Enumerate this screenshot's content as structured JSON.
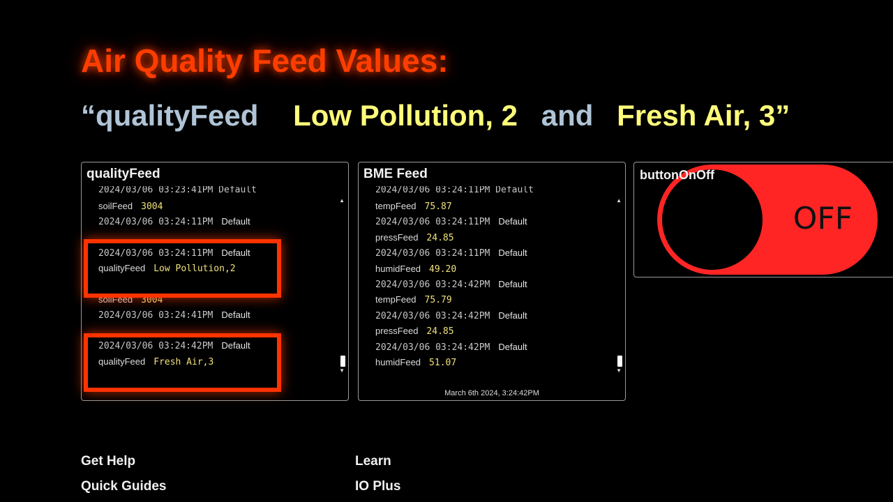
{
  "heading": "Air Quality Feed Values:",
  "subheading": {
    "open_quote": "“",
    "feed_name": "qualityFeed",
    "value1": "Low Pollution, 2",
    "and_word": "and",
    "value2": "Fresh Air, 3”"
  },
  "quality_panel": {
    "title": "qualityFeed",
    "clipped_line": "2024/03/06 03:23:41PM  Default",
    "rows": [
      {
        "feed": "soilFeed",
        "value": "3004"
      },
      {
        "timestamp": "2024/03/06 03:24:11PM",
        "group": "Default"
      },
      {
        "timestamp": "2024/03/06 03:24:11PM",
        "group": "Default"
      },
      {
        "feed": "qualityFeed",
        "value": "Low Pollution,2"
      },
      {
        "feed": "soilFeed",
        "value": "3004"
      },
      {
        "timestamp": "2024/03/06 03:24:41PM",
        "group": "Default"
      },
      {
        "timestamp": "2024/03/06 03:24:42PM",
        "group": "Default"
      },
      {
        "feed": "qualityFeed",
        "value": "Fresh Air,3"
      }
    ]
  },
  "bme_panel": {
    "title": "BME Feed",
    "clipped_line": "2024/03/06 03:24:11PM  Default",
    "rows": [
      {
        "feed": "tempFeed",
        "value": "75.87"
      },
      {
        "timestamp": "2024/03/06 03:24:11PM",
        "group": "Default"
      },
      {
        "feed": "pressFeed",
        "value": "24.85"
      },
      {
        "timestamp": "2024/03/06 03:24:11PM",
        "group": "Default"
      },
      {
        "feed": "humidFeed",
        "value": "49.20"
      },
      {
        "timestamp": "2024/03/06 03:24:42PM",
        "group": "Default"
      },
      {
        "feed": "tempFeed",
        "value": "75.79"
      },
      {
        "timestamp": "2024/03/06 03:24:42PM",
        "group": "Default"
      },
      {
        "feed": "pressFeed",
        "value": "24.85"
      },
      {
        "timestamp": "2024/03/06 03:24:42PM",
        "group": "Default"
      },
      {
        "feed": "humidFeed",
        "value": "51.07"
      }
    ],
    "footer": "March 6th 2024, 3:24:42PM"
  },
  "toggle_panel": {
    "title": "buttonOnOff",
    "state_label": "OFF",
    "state": "off"
  },
  "footer_links": {
    "get_help": "Get Help",
    "quick_guides": "Quick Guides",
    "learn": "Learn",
    "io_plus": "IO Plus"
  },
  "colors": {
    "heading": "#ff3d00",
    "highlight": "#ff3300",
    "value_yellow": "#f1e17a",
    "toggle_track": "#ff2525"
  }
}
